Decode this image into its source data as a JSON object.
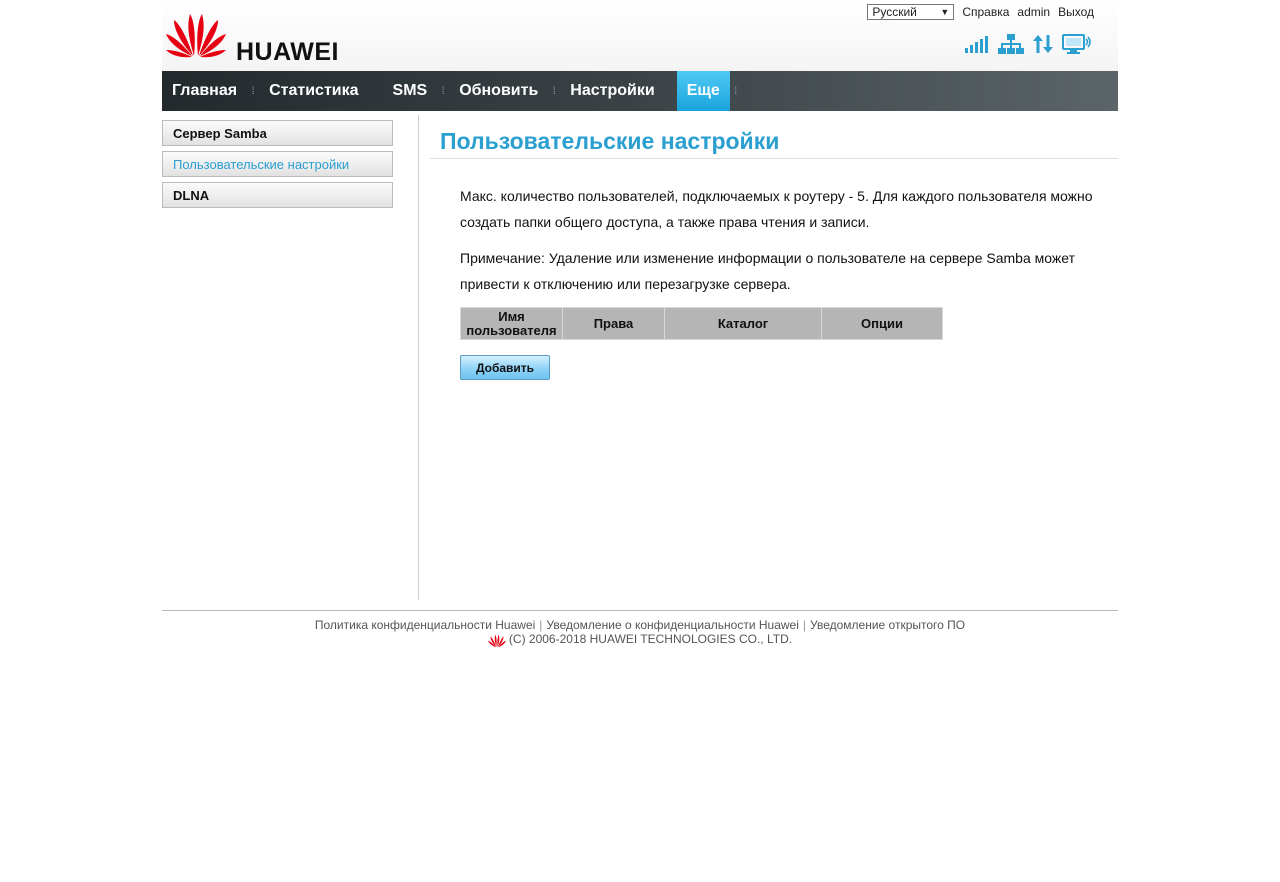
{
  "brand": {
    "name": "HUAWEI",
    "color": "#e60012"
  },
  "top": {
    "language": "Русский",
    "help": "Справка",
    "user": "admin",
    "logout": "Выход"
  },
  "status_icons": [
    "signal-strength-icon",
    "network-icon",
    "data-transfer-icon",
    "wifi-device-icon"
  ],
  "nav": {
    "items": [
      {
        "label": "Главная"
      },
      {
        "label": "Статистика"
      },
      {
        "label": "SMS"
      },
      {
        "label": "Обновить"
      },
      {
        "label": "Настройки"
      },
      {
        "label": "Еще",
        "active": true
      }
    ]
  },
  "sidebar": {
    "items": [
      {
        "label": "Сервер Samba"
      },
      {
        "label": "Пользовательские настройки",
        "active": true
      },
      {
        "label": "DLNA"
      }
    ]
  },
  "main": {
    "title": "Пользовательские настройки",
    "paragraph1": "Макс. количество пользователей, подключаемых к роутеру - 5. Для каждого пользователя можно создать папки общего доступа, а также права чтения и записи.",
    "paragraph2": "Примечание: Удаление или изменение информации о пользователе на сервере Samba может привести к отключению или перезагрузке сервера.",
    "table": {
      "columns": [
        "Имя пользователя",
        "Права",
        "Каталог",
        "Опции"
      ],
      "rows": []
    },
    "add_button": "Добавить"
  },
  "footer": {
    "links": [
      "Политика конфиденциальности Huawei",
      "Уведомление о конфиденциальности Huawei",
      "Уведомление открытого ПО"
    ],
    "copyright": "(C) 2006-2018 HUAWEI TECHNOLOGIES CO., LTD."
  },
  "colors": {
    "accent": "#2a9fd0",
    "nav_active": "#1aa4dc"
  }
}
